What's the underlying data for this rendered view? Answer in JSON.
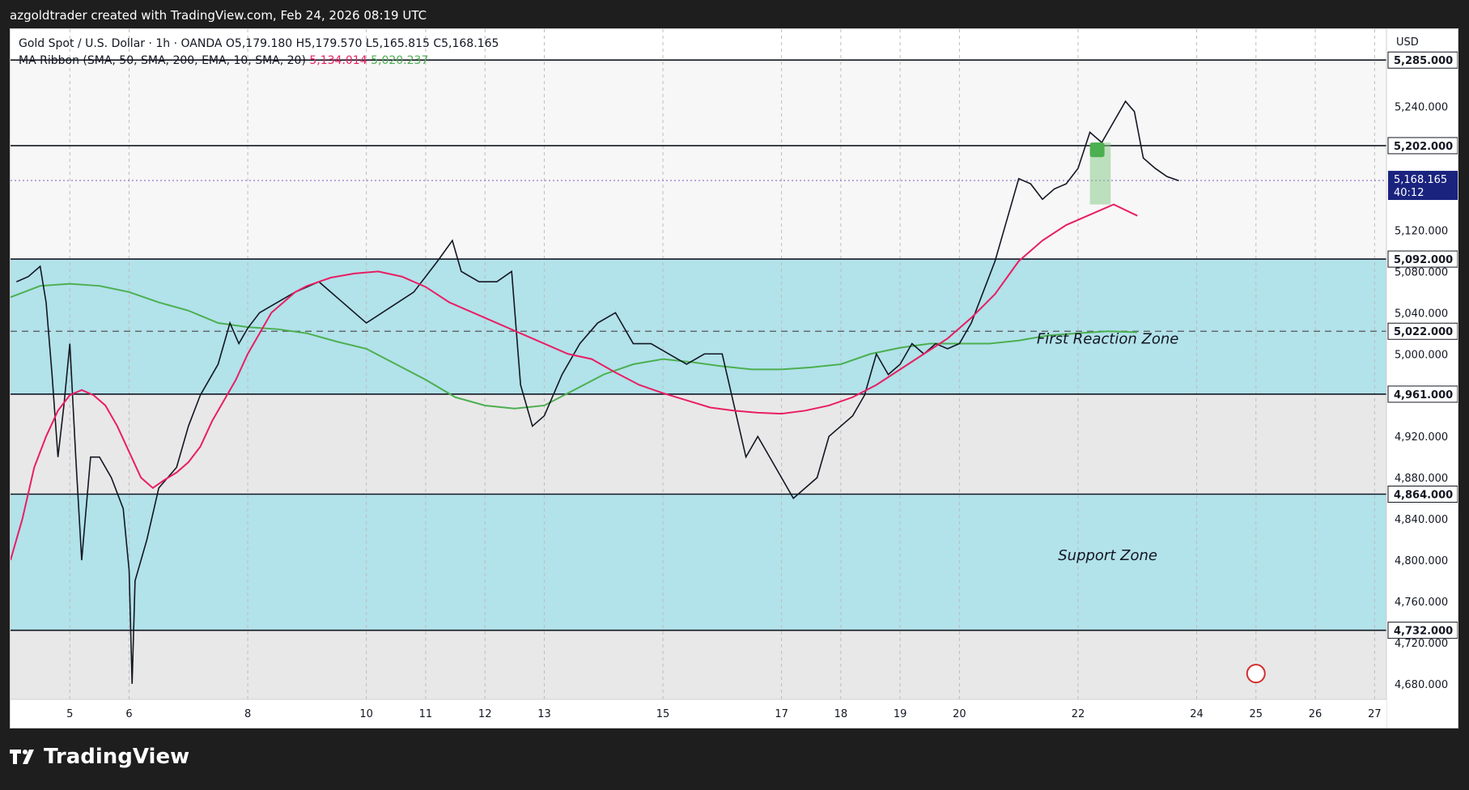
{
  "caption": "azgoldtrader created with TradingView.com, Feb 24, 2026 08:19 UTC",
  "footer": {
    "brand": "TradingView"
  },
  "legend": {
    "symbol": "Gold Spot / U.S. Dollar · 1h · OANDA",
    "ohlc": "O5,179.180 H5,179.570 L5,165.815 C5,168.165",
    "ribbon": "MA Ribbon (SMA, 50, SMA, 200, EMA, 10, SMA, 20)",
    "ribbon_v1": "5,134.014",
    "ribbon_v2": "5,020.237"
  },
  "currency": "USD",
  "colors": {
    "pink": "#e91e63",
    "green": "#4caf50",
    "zone": "#b2e2ea",
    "grey": "#e8e8e8",
    "cursor_label": "#1a237e"
  },
  "chart_data": {
    "type": "line",
    "title": "",
    "ylim": [
      4665,
      5315
    ],
    "x_ticks": [
      {
        "label": "5",
        "x": 5
      },
      {
        "label": "6",
        "x": 6
      },
      {
        "label": "8",
        "x": 8
      },
      {
        "label": "10",
        "x": 10
      },
      {
        "label": "11",
        "x": 11
      },
      {
        "label": "12",
        "x": 12
      },
      {
        "label": "13",
        "x": 13
      },
      {
        "label": "15",
        "x": 15
      },
      {
        "label": "17",
        "x": 17
      },
      {
        "label": "18",
        "x": 18
      },
      {
        "label": "19",
        "x": 19
      },
      {
        "label": "20",
        "x": 20
      },
      {
        "label": "22",
        "x": 22
      },
      {
        "label": "24",
        "x": 24
      },
      {
        "label": "25",
        "x": 25
      },
      {
        "label": "26",
        "x": 26
      },
      {
        "label": "27",
        "x": 27
      }
    ],
    "y_ticks": [
      4680,
      4720,
      4760,
      4800,
      4840,
      4880,
      4920,
      5000,
      5040,
      5080,
      5120,
      5240
    ],
    "y_tick_labels": [
      "4,680.000",
      "4,720.000",
      "4,760.000",
      "4,800.000",
      "4,840.000",
      "4,880.000",
      "4,920.000",
      "5,000.000",
      "5,040.000",
      "5,080.000",
      "5,120.000",
      "5,240.000"
    ],
    "levels": [
      {
        "value": 5285,
        "label": "5,285.000"
      },
      {
        "value": 5202,
        "label": "5,202.000"
      },
      {
        "value": 5092,
        "label": "5,092.000"
      },
      {
        "value": 5022,
        "label": "5,022.000",
        "dashed": true
      },
      {
        "value": 4961,
        "label": "4,961.000"
      },
      {
        "value": 4864,
        "label": "4,864.000"
      },
      {
        "value": 4732,
        "label": "4,732.000"
      }
    ],
    "zones": [
      {
        "from": 4961,
        "to": 5092,
        "label": "First Reaction Zone"
      },
      {
        "from": 4732,
        "to": 4864,
        "label": "Support Zone"
      }
    ],
    "current": {
      "value": 5168.165,
      "label": "5,168.165",
      "countdown": "40:12"
    },
    "series": [
      {
        "name": "",
        "color": "#131722",
        "points": [
          [
            4.1,
            5070
          ],
          [
            4.3,
            5075
          ],
          [
            4.5,
            5085
          ],
          [
            4.6,
            5050
          ],
          [
            4.7,
            4980
          ],
          [
            4.8,
            4900
          ],
          [
            4.9,
            4950
          ],
          [
            5.0,
            5010
          ],
          [
            5.1,
            4900
          ],
          [
            5.2,
            4800
          ],
          [
            5.35,
            4900
          ],
          [
            5.5,
            4900
          ],
          [
            5.7,
            4880
          ],
          [
            5.9,
            4850
          ],
          [
            6.0,
            4790
          ],
          [
            6.05,
            4680
          ],
          [
            6.1,
            4780
          ],
          [
            6.3,
            4820
          ],
          [
            6.5,
            4870
          ],
          [
            6.8,
            4890
          ],
          [
            7.0,
            4930
          ],
          [
            7.2,
            4960
          ],
          [
            7.5,
            4990
          ],
          [
            7.7,
            5030
          ],
          [
            7.85,
            5010
          ],
          [
            8.0,
            5025
          ],
          [
            8.2,
            5040
          ],
          [
            8.5,
            5050
          ],
          [
            8.8,
            5060
          ],
          [
            9.2,
            5070
          ],
          [
            9.6,
            5050
          ],
          [
            10.0,
            5030
          ],
          [
            10.4,
            5045
          ],
          [
            10.8,
            5060
          ],
          [
            11.2,
            5090
          ],
          [
            11.45,
            5110
          ],
          [
            11.6,
            5080
          ],
          [
            11.9,
            5070
          ],
          [
            12.2,
            5070
          ],
          [
            12.45,
            5080
          ],
          [
            12.6,
            4970
          ],
          [
            12.8,
            4930
          ],
          [
            13.0,
            4940
          ],
          [
            13.3,
            4980
          ],
          [
            13.6,
            5010
          ],
          [
            13.9,
            5030
          ],
          [
            14.2,
            5040
          ],
          [
            14.5,
            5010
          ],
          [
            14.8,
            5010
          ],
          [
            15.1,
            5000
          ],
          [
            15.4,
            4990
          ],
          [
            15.7,
            5000
          ],
          [
            16.0,
            5000
          ],
          [
            16.2,
            4950
          ],
          [
            16.4,
            4900
          ],
          [
            16.6,
            4920
          ],
          [
            16.8,
            4900
          ],
          [
            17.0,
            4880
          ],
          [
            17.2,
            4860
          ],
          [
            17.4,
            4870
          ],
          [
            17.6,
            4880
          ],
          [
            17.8,
            4920
          ],
          [
            18.0,
            4930
          ],
          [
            18.2,
            4940
          ],
          [
            18.4,
            4960
          ],
          [
            18.6,
            5000
          ],
          [
            18.8,
            4980
          ],
          [
            19.0,
            4990
          ],
          [
            19.2,
            5010
          ],
          [
            19.4,
            5000
          ],
          [
            19.6,
            5010
          ],
          [
            19.8,
            5005
          ],
          [
            20.0,
            5010
          ],
          [
            20.2,
            5030
          ],
          [
            20.4,
            5060
          ],
          [
            20.6,
            5090
          ],
          [
            20.8,
            5130
          ],
          [
            21.0,
            5170
          ],
          [
            21.2,
            5165
          ],
          [
            21.4,
            5150
          ],
          [
            21.6,
            5160
          ],
          [
            21.8,
            5165
          ],
          [
            22.0,
            5180
          ],
          [
            22.2,
            5215
          ],
          [
            22.4,
            5205
          ],
          [
            22.6,
            5225
          ],
          [
            22.8,
            5245
          ],
          [
            22.95,
            5235
          ],
          [
            23.1,
            5190
          ],
          [
            23.3,
            5180
          ],
          [
            23.5,
            5172
          ],
          [
            23.7,
            5168
          ]
        ]
      },
      {
        "name": "",
        "color": "#e91e63",
        "points": [
          [
            4.0,
            4800
          ],
          [
            4.2,
            4840
          ],
          [
            4.4,
            4890
          ],
          [
            4.6,
            4920
          ],
          [
            4.8,
            4945
          ],
          [
            5.0,
            4960
          ],
          [
            5.2,
            4965
          ],
          [
            5.4,
            4960
          ],
          [
            5.6,
            4950
          ],
          [
            5.8,
            4930
          ],
          [
            6.0,
            4905
          ],
          [
            6.2,
            4880
          ],
          [
            6.4,
            4870
          ],
          [
            6.6,
            4878
          ],
          [
            6.8,
            4885
          ],
          [
            7.0,
            4895
          ],
          [
            7.2,
            4910
          ],
          [
            7.4,
            4935
          ],
          [
            7.6,
            4955
          ],
          [
            7.8,
            4975
          ],
          [
            8.0,
            5000
          ],
          [
            8.2,
            5020
          ],
          [
            8.4,
            5040
          ],
          [
            8.6,
            5050
          ],
          [
            8.8,
            5060
          ],
          [
            9.0,
            5066
          ],
          [
            9.4,
            5074
          ],
          [
            9.8,
            5078
          ],
          [
            10.2,
            5080
          ],
          [
            10.6,
            5075
          ],
          [
            11.0,
            5065
          ],
          [
            11.4,
            5050
          ],
          [
            11.8,
            5040
          ],
          [
            12.2,
            5030
          ],
          [
            12.6,
            5020
          ],
          [
            13.0,
            5010
          ],
          [
            13.4,
            5000
          ],
          [
            13.8,
            4995
          ],
          [
            14.2,
            4982
          ],
          [
            14.6,
            4970
          ],
          [
            15.0,
            4962
          ],
          [
            15.4,
            4955
          ],
          [
            15.8,
            4948
          ],
          [
            16.2,
            4945
          ],
          [
            16.6,
            4943
          ],
          [
            17.0,
            4942
          ],
          [
            17.4,
            4945
          ],
          [
            17.8,
            4950
          ],
          [
            18.2,
            4958
          ],
          [
            18.6,
            4970
          ],
          [
            19.0,
            4985
          ],
          [
            19.4,
            5000
          ],
          [
            19.8,
            5015
          ],
          [
            20.2,
            5035
          ],
          [
            20.6,
            5058
          ],
          [
            21.0,
            5090
          ],
          [
            21.4,
            5110
          ],
          [
            21.8,
            5125
          ],
          [
            22.2,
            5135
          ],
          [
            22.6,
            5145
          ],
          [
            23.0,
            5134
          ]
        ]
      }
    ],
    "annotations": [
      "First Reaction Zone",
      "Support Zone"
    ]
  }
}
